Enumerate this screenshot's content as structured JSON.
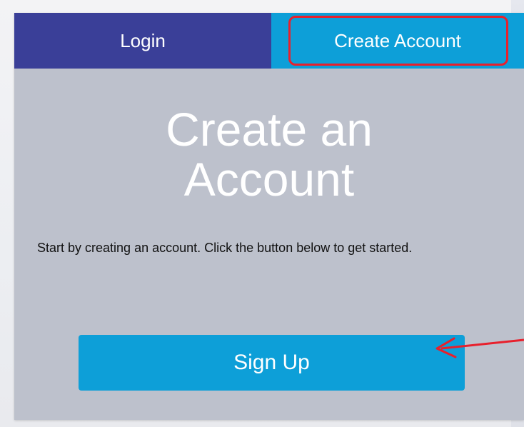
{
  "tabs": {
    "login_label": "Login",
    "create_label": "Create Account"
  },
  "main": {
    "heading_line1": "Create an",
    "heading_line2": "Account",
    "description": "Start by creating an account. Click the button below to get started.",
    "signup_label": "Sign Up"
  },
  "colors": {
    "login_tab": "#3a3f98",
    "create_tab": "#0d9fd8",
    "panel": "#bdc1cc",
    "annotation": "#e8202c"
  }
}
